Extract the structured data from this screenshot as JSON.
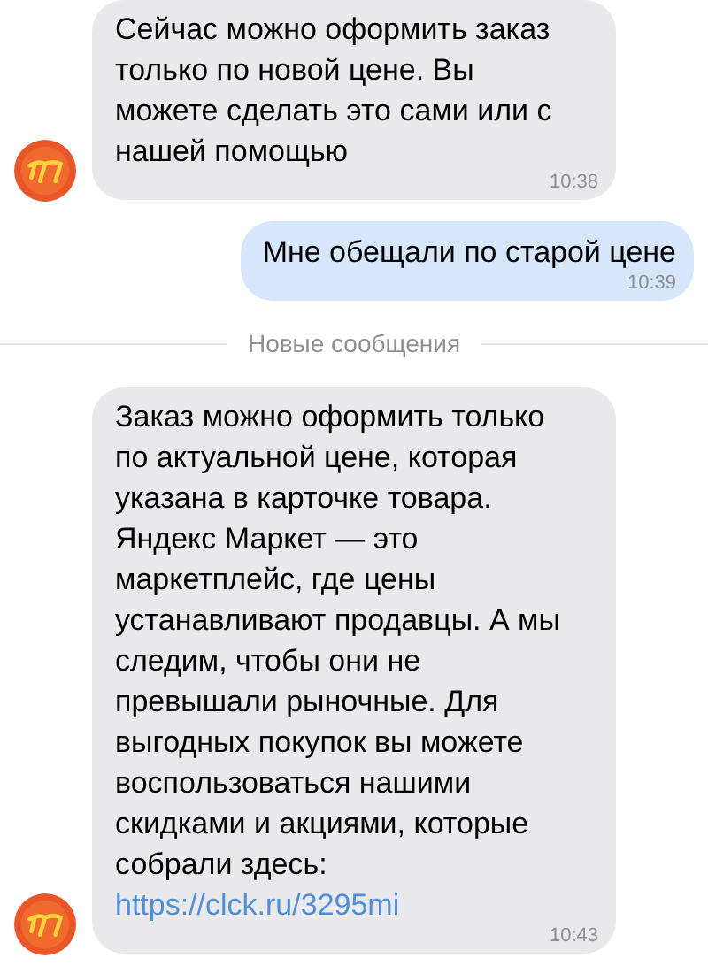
{
  "messages": [
    {
      "kind": "incoming",
      "avatar": true,
      "text": "Сейчас можно оформить заказ только по новой цене. Вы можете сделать это сами или с нашей помощью",
      "time": "10:38"
    },
    {
      "kind": "outgoing",
      "text": "Мне обещали по старой цене",
      "time": "10:39"
    },
    {
      "kind": "divider",
      "text": "Новые сообщения"
    },
    {
      "kind": "incoming",
      "avatar": true,
      "text": "Заказ можно оформить только по актуальной цене, которая указана в карточке товара. Яндекс Маркет — это маркетплейс, где цены устанавливают продавцы. А мы следим, чтобы они не превышали рыночные. Для выгодных покупок вы можете воспользоваться нашими скидками и акциями, которые собрали здесь:",
      "link": "https://clck.ru/3295mi",
      "time": "10:43"
    }
  ]
}
